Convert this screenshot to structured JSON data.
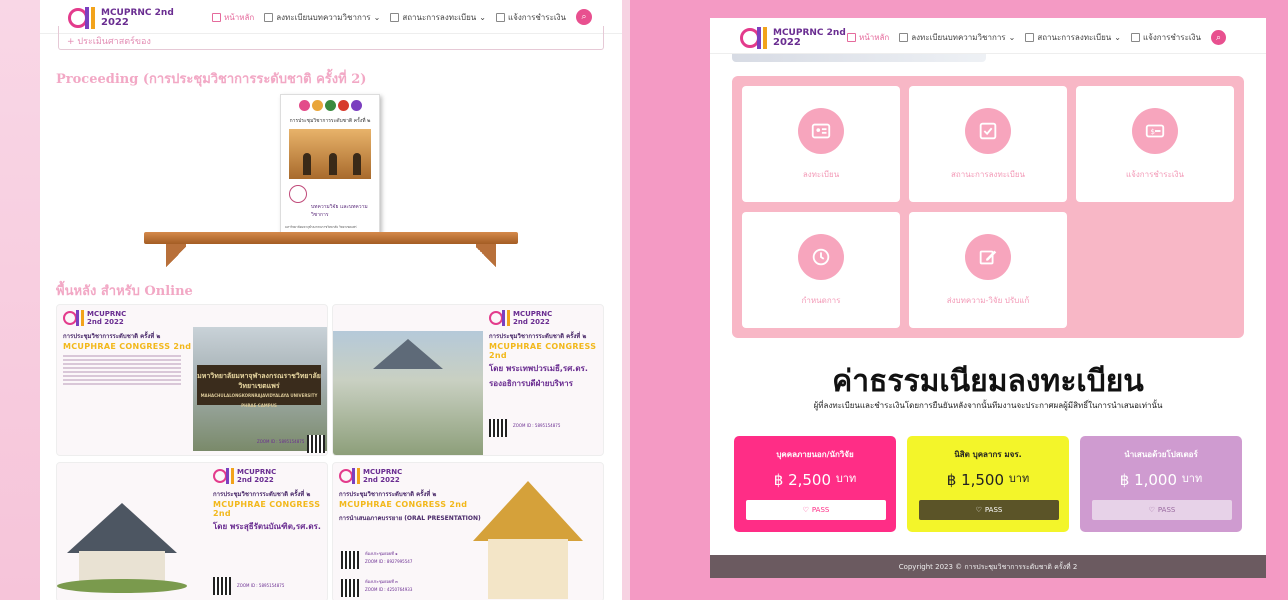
{
  "left": {
    "logo": {
      "line1": "MCUPRNC 2nd",
      "line2": "2022"
    },
    "nav": {
      "home": "หน้าหลัก",
      "submit": "ลงทะเบียนบทความวิชาการ",
      "status": "สถานะการลงทะเบียน",
      "payment": "แจ้งการชำระเงิน"
    },
    "collapse_text": "+ ประเมินศาสตร์ของ",
    "proceeding_title": "Proceeding (การประชุมวิชาการระดับชาติ ครั้งที่ 2)",
    "book": {
      "title": "การประชุมวิชาการระดับชาติ ครั้งที่ ๒",
      "subtitle": "บทความวิจัย และบทความวิชาการ",
      "publisher": "มหาวิทยาลัยมหาจุฬาลงกรณราชวิทยาลัย วิทยาเขตแพร่"
    },
    "background_title": "พื้นหลัง สำหรับ Online",
    "cards": [
      {
        "logo": "MCUPRNC 2nd 2022",
        "h1": "การประชุมวิชาการระดับชาติ ครั้งที่ ๒",
        "h2": "MCUPHRAE CONGRESS 2nd",
        "sign": "มหาวิทยาลัยมหาจุฬาลงกรณราชวิทยาลัย วิทยาเขตแพร่",
        "sign_en": "MAHACHULALONGKORNRAJAVIDYALAYA UNIVERSITY PHRAE CAMPUS",
        "zoom": "ZOOM ID : 5895154875"
      },
      {
        "logo": "MCUPRNC 2nd 2022",
        "h1": "การประชุมวิชาการระดับชาติ ครั้งที่ ๒",
        "h2": "MCUPHRAE CONGRESS 2nd",
        "h3a": "โดย พระเทพปวรเมธี,รศ.ดร.",
        "h3b": "รองอธิการบดีฝ่ายบริหาร",
        "zoom": "ZOOM ID : 5895154875"
      },
      {
        "logo": "MCUPRNC 2nd 2022",
        "h1": "การประชุมวิชาการระดับชาติ ครั้งที่ ๒",
        "h2": "MCUPHRAE CONGRESS 2nd",
        "h3": "โดย พระสุธีรัตนบัณฑิต,รศ.ดร.",
        "zoom": "ZOOM ID : 5895154875"
      },
      {
        "logo": "MCUPRNC 2nd 2022",
        "h1": "การประชุมวิชาการระดับชาติ ครั้งที่ ๒",
        "h2": "MCUPHRAE CONGRESS 2nd",
        "h3": "การนำเสนอภาคบรรยาย (ORAL PRESENTATION)",
        "room1": "ห้องประชุมย่อยที่ ๑",
        "zoom1": "ZOOM ID : 8927995547",
        "room2": "ห้องประชุมย่อยที่ ๓",
        "zoom2": "ZOOM ID : 4250764933"
      }
    ]
  },
  "right": {
    "logo": {
      "line1": "MCUPRNC 2nd",
      "line2": "2022"
    },
    "nav": {
      "home": "หน้าหลัก",
      "submit": "ลงทะเบียนบทความวิชาการ",
      "status": "สถานะการลงทะเบียน",
      "payment": "แจ้งการชำระเงิน"
    },
    "tiles": [
      {
        "label": "ลงทะเบียน",
        "icon": "id-card-icon"
      },
      {
        "label": "สถานะการลงทะเบียน",
        "icon": "checkbox-icon"
      },
      {
        "label": "แจ้งการชำระเงิน",
        "icon": "money-icon"
      },
      {
        "label": "กำหนดการ",
        "icon": "clock-icon"
      },
      {
        "label": "ส่งบทความ-วิจัย ปรับแก้",
        "icon": "edit-icon"
      }
    ],
    "fee_title": "ค่าธรรมเนียมลงทะเบียน",
    "fee_subtitle": "ผู้ที่ลงทะเบียนและชำระเงินโดยการยืนยันหลังจากนั้นทีมงานจะประกาศผลผู้มีสิทธิ์ในการนำเสนอเท่านั้น",
    "prices": [
      {
        "title": "บุคคลภายนอก/นักวิจัย",
        "amount": "2,500",
        "currency": "฿",
        "unit": "บาท",
        "pass": "PASS",
        "bg": "#ff2d86",
        "fg": "#ffffff",
        "passbg": "#ffffff",
        "passfg": "#ff2d86"
      },
      {
        "title": "นิสิต บุคลากร มจร.",
        "amount": "1,500",
        "currency": "฿",
        "unit": "บาท",
        "pass": "PASS",
        "bg": "#f3f52a",
        "fg": "#222222",
        "passbg": "#5b5428",
        "passfg": "#ffffff"
      },
      {
        "title": "นำเสนอด้วยโปสเตอร์",
        "amount": "1,000",
        "currency": "฿",
        "unit": "บาท",
        "pass": "PASS",
        "bg": "#cf9bd0",
        "fg": "#ffffff",
        "passbg": "#e7d2e8",
        "passfg": "#9a6ba0"
      }
    ],
    "footer": "Copyright 2023 © การประชุมวิชาการระดับชาติ ครั้งที่ 2"
  }
}
